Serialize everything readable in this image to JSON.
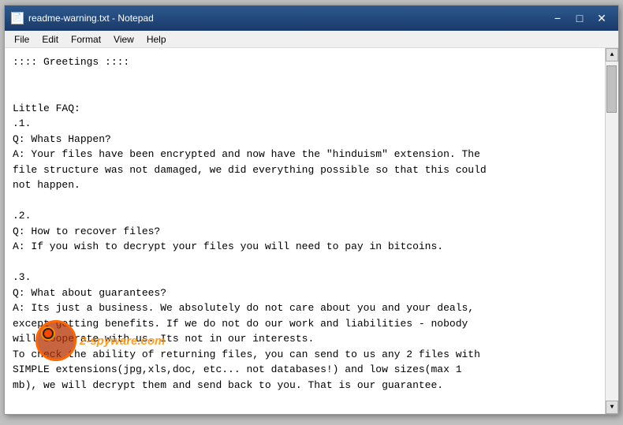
{
  "window": {
    "title": "readme-warning.txt - Notepad",
    "icon": "📄"
  },
  "titlebar": {
    "minimize": "−",
    "maximize": "□",
    "close": "✕"
  },
  "menubar": {
    "items": [
      "File",
      "Edit",
      "Format",
      "View",
      "Help"
    ]
  },
  "content": {
    "text": ":::: Greetings ::::\n\n\nLittle FAQ:\n.1.\nQ: Whats Happen?\nA: Your files have been encrypted and now have the \"hinduism\" extension. The\nfile structure was not damaged, we did everything possible so that this could\nnot happen.\n\n.2.\nQ: How to recover files?\nA: If you wish to decrypt your files you will need to pay in bitcoins.\n\n.3.\nQ: What about guarantees?\nA: Its just a business. We absolutely do not care about you and your deals,\nexcept getting benefits. If we do not do our work and liabilities - nobody\nwill cooperate with us. Its not in our interests.\nTo check the ability of returning files, you can send to us any 2 files with\nSIMPLE extensions(jpg,xls,doc, etc... not databases!) and low sizes(max 1\nmb), we will decrypt them and send back to you. That is our guarantee."
  },
  "watermark": {
    "text": "2-spyware.com"
  }
}
